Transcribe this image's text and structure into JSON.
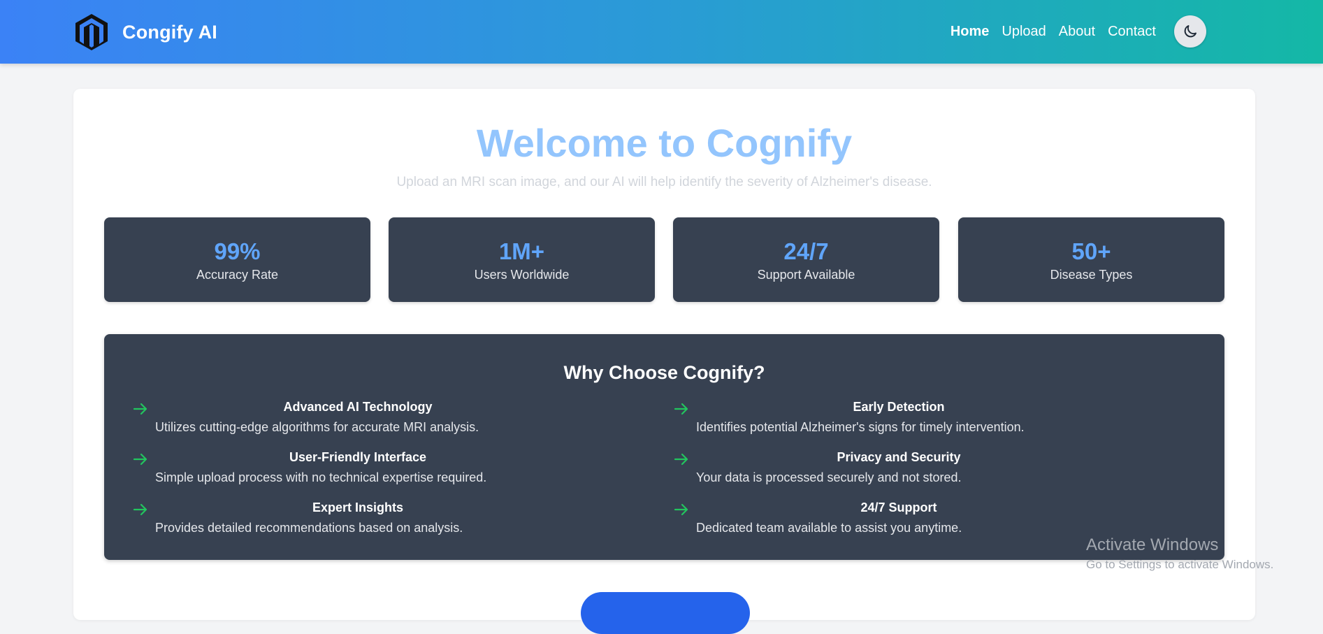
{
  "brand": {
    "name": "Congify AI",
    "logo_icon": "magento-style-logo-icon"
  },
  "nav": {
    "links": [
      {
        "label": "Home",
        "active": true
      },
      {
        "label": "Upload",
        "active": false
      },
      {
        "label": "About",
        "active": false
      },
      {
        "label": "Contact",
        "active": false
      }
    ],
    "theme_toggle_icon": "moon-icon"
  },
  "hero": {
    "title": "Welcome to Cognify",
    "subtitle": "Upload an MRI scan image, and our AI will help identify the severity of Alzheimer's disease."
  },
  "stats": [
    {
      "value": "99%",
      "label": "Accuracy Rate"
    },
    {
      "value": "1M+",
      "label": "Users Worldwide"
    },
    {
      "value": "24/7",
      "label": "Support Available"
    },
    {
      "value": "50+",
      "label": "Disease Types"
    }
  ],
  "why": {
    "title": "Why Choose Cognify?",
    "features": [
      {
        "name": "Advanced AI Technology",
        "desc": "Utilizes cutting-edge algorithms for accurate MRI analysis."
      },
      {
        "name": "Early Detection",
        "desc": "Identifies potential Alzheimer's signs for timely intervention."
      },
      {
        "name": "User-Friendly Interface",
        "desc": "Simple upload process with no technical expertise required."
      },
      {
        "name": "Privacy and Security",
        "desc": "Your data is processed securely and not stored."
      },
      {
        "name": "Expert Insights",
        "desc": "Provides detailed recommendations based on analysis."
      },
      {
        "name": "24/7 Support",
        "desc": "Dedicated team available to assist you anytime."
      }
    ],
    "arrow_icon": "arrow-right-icon"
  },
  "watermark": {
    "title": "Activate Windows",
    "subtitle": "Go to Settings to activate Windows."
  },
  "colors": {
    "accent": "#60a5fa",
    "panel": "#374151",
    "arrow": "#22c55e",
    "cta": "#2563eb"
  }
}
